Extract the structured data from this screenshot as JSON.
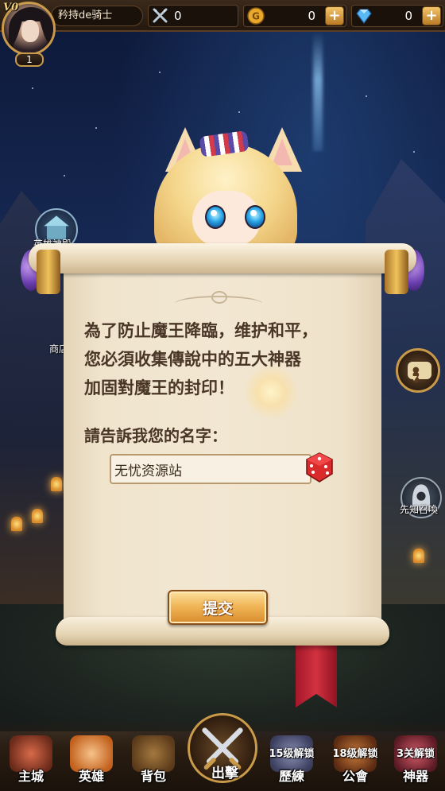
{
  "player": {
    "vip": "V0",
    "name": "矜持de骑士",
    "level": "1"
  },
  "resources": {
    "power": "0",
    "gold": "0",
    "diamonds": "0"
  },
  "side": {
    "hero_shrine": "英雄神殿",
    "shop": "商店",
    "prophet_summon": "先知召喚"
  },
  "dialog": {
    "story_lines": [
      "為了防止魔王降臨，维护和平，",
      "您必須收集傳說中的五大神器",
      "加固對魔王的封印！"
    ],
    "prompt": "請告訴我您的名字：",
    "name_value": "无忧资源站",
    "submit_label": "提交"
  },
  "nav": {
    "items": [
      {
        "label": "主城"
      },
      {
        "label": "英雄"
      },
      {
        "label": "背包"
      },
      {
        "label": "出擊"
      },
      {
        "label": "歷練",
        "lock": "15级解锁"
      },
      {
        "label": "公會",
        "lock": "18级解锁"
      },
      {
        "label": "神器",
        "lock": "3关解锁"
      }
    ]
  },
  "colors": {
    "scroll": "#f2e7d2",
    "story_text": "#4a3626",
    "button": "#f1b759",
    "frame_gold": "#c99a4a"
  }
}
